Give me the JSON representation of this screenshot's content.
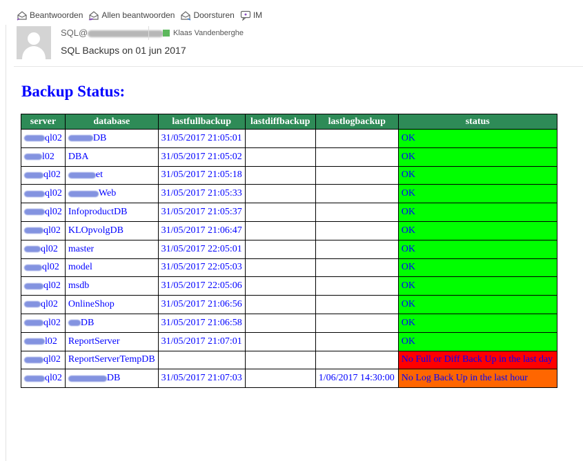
{
  "toolbar": {
    "reply": "Beantwoorden",
    "reply_all": "Allen beantwoorden",
    "forward": "Doorsturen",
    "im": "IM"
  },
  "header": {
    "sender_prefix": "SQL@",
    "recipient": "Klaas Vandenberghe",
    "presence_color": "#5cb85c",
    "subject": "SQL Backups on 01 jun 2017"
  },
  "body": {
    "title": "Backup Status:"
  },
  "table": {
    "columns": [
      "server",
      "database",
      "lastfullbackup",
      "lastdiffbackup",
      "lastlogbackup",
      "status"
    ],
    "rows": [
      {
        "server": "ql02",
        "database": "DB",
        "lastfullbackup": "31/05/2017 21:05:01",
        "lastdiffbackup": "",
        "lastlogbackup": "",
        "status": "OK",
        "level": "ok"
      },
      {
        "server": "l02",
        "database": "DBA",
        "lastfullbackup": "31/05/2017 21:05:02",
        "lastdiffbackup": "",
        "lastlogbackup": "",
        "status": "OK",
        "level": "ok"
      },
      {
        "server": "ql02",
        "database": "et",
        "lastfullbackup": "31/05/2017 21:05:18",
        "lastdiffbackup": "",
        "lastlogbackup": "",
        "status": "OK",
        "level": "ok"
      },
      {
        "server": "ql02",
        "database": "Web",
        "lastfullbackup": "31/05/2017 21:05:33",
        "lastdiffbackup": "",
        "lastlogbackup": "",
        "status": "OK",
        "level": "ok"
      },
      {
        "server": "ql02",
        "database": "InfoproductDB",
        "lastfullbackup": "31/05/2017 21:05:37",
        "lastdiffbackup": "",
        "lastlogbackup": "",
        "status": "OK",
        "level": "ok"
      },
      {
        "server": "ql02",
        "database": "KLOpvolgDB",
        "lastfullbackup": "31/05/2017 21:06:47",
        "lastdiffbackup": "",
        "lastlogbackup": "",
        "status": "OK",
        "level": "ok"
      },
      {
        "server": "ql02",
        "database": "master",
        "lastfullbackup": "31/05/2017 22:05:01",
        "lastdiffbackup": "",
        "lastlogbackup": "",
        "status": "OK",
        "level": "ok"
      },
      {
        "server": "ql02",
        "database": "model",
        "lastfullbackup": "31/05/2017 22:05:03",
        "lastdiffbackup": "",
        "lastlogbackup": "",
        "status": "OK",
        "level": "ok"
      },
      {
        "server": "ql02",
        "database": "msdb",
        "lastfullbackup": "31/05/2017 22:05:06",
        "lastdiffbackup": "",
        "lastlogbackup": "",
        "status": "OK",
        "level": "ok"
      },
      {
        "server": "ql02",
        "database": "OnlineShop",
        "lastfullbackup": "31/05/2017 21:06:56",
        "lastdiffbackup": "",
        "lastlogbackup": "",
        "status": "OK",
        "level": "ok"
      },
      {
        "server": "ql02",
        "database": "DB",
        "lastfullbackup": "31/05/2017 21:06:58",
        "lastdiffbackup": "",
        "lastlogbackup": "",
        "status": "OK",
        "level": "ok"
      },
      {
        "server": "l02",
        "database": "ReportServer",
        "lastfullbackup": "31/05/2017 21:07:01",
        "lastdiffbackup": "",
        "lastlogbackup": "",
        "status": "OK",
        "level": "ok"
      },
      {
        "server": "ql02",
        "database": "ReportServerTempDB",
        "lastfullbackup": "",
        "lastdiffbackup": "",
        "lastlogbackup": "",
        "status": "No Full or Diff Back Up in the last day",
        "level": "err"
      },
      {
        "server": "ql02",
        "database": "DB",
        "lastfullbackup": "31/05/2017 21:07:03",
        "lastdiffbackup": "",
        "lastlogbackup": "1/06/2017 14:30:00",
        "status": "No Log Back Up in the last hour",
        "level": "warn"
      }
    ]
  },
  "colors": {
    "header_bg": "#2e8b57",
    "ok": "#00ff00",
    "error": "#ff0000",
    "warning": "#ff6600",
    "text": "#0000ff"
  }
}
